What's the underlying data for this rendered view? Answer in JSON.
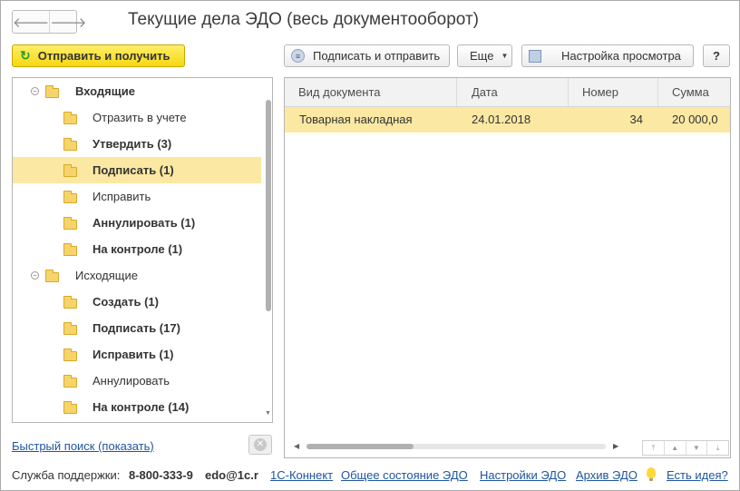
{
  "window": {
    "title": "Текущие дела ЭДО (весь документооборот)"
  },
  "nav": {
    "back": "🡐",
    "forward": "🡒"
  },
  "toolbar": {
    "send_receive": "Отправить и получить",
    "sign_send": "Подписать и отправить",
    "more": "Еще",
    "view_settings": "Настройка просмотра",
    "help": "?"
  },
  "tree": {
    "incoming": {
      "label": "Входящие",
      "items": [
        {
          "label": "Отразить в учете"
        },
        {
          "label": "Утвердить (3)"
        },
        {
          "label": "Подписать (1)"
        },
        {
          "label": "Исправить"
        },
        {
          "label": "Аннулировать (1)"
        },
        {
          "label": "На контроле (1)"
        }
      ]
    },
    "outgoing": {
      "label": "Исходящие",
      "items": [
        {
          "label": "Создать (1)"
        },
        {
          "label": "Подписать (17)"
        },
        {
          "label": "Исправить (1)"
        },
        {
          "label": "Аннулировать"
        },
        {
          "label": "На контроле (14)"
        }
      ]
    }
  },
  "table": {
    "columns": [
      "Вид документа",
      "Дата",
      "Номер",
      "Сумма"
    ],
    "rows": [
      {
        "type": "Товарная накладная",
        "date": "24.01.2018",
        "number": "34",
        "sum": "20 000,0"
      }
    ]
  },
  "quick_search": "Быстрый поиск (показать)",
  "footer": {
    "support_label": "Служба поддержки:",
    "phone": "8-800-333-9",
    "email": "edo@1c.r",
    "connect": "1С-Коннект",
    "status": "Общее состояние ЭДО",
    "settings": "Настройки ЭДО",
    "archive": "Архив ЭДО",
    "idea": "Есть идея?"
  },
  "colors": {
    "primary_button": "#f5d80f",
    "selection": "#fbe8a2",
    "link": "#1f55a0"
  }
}
